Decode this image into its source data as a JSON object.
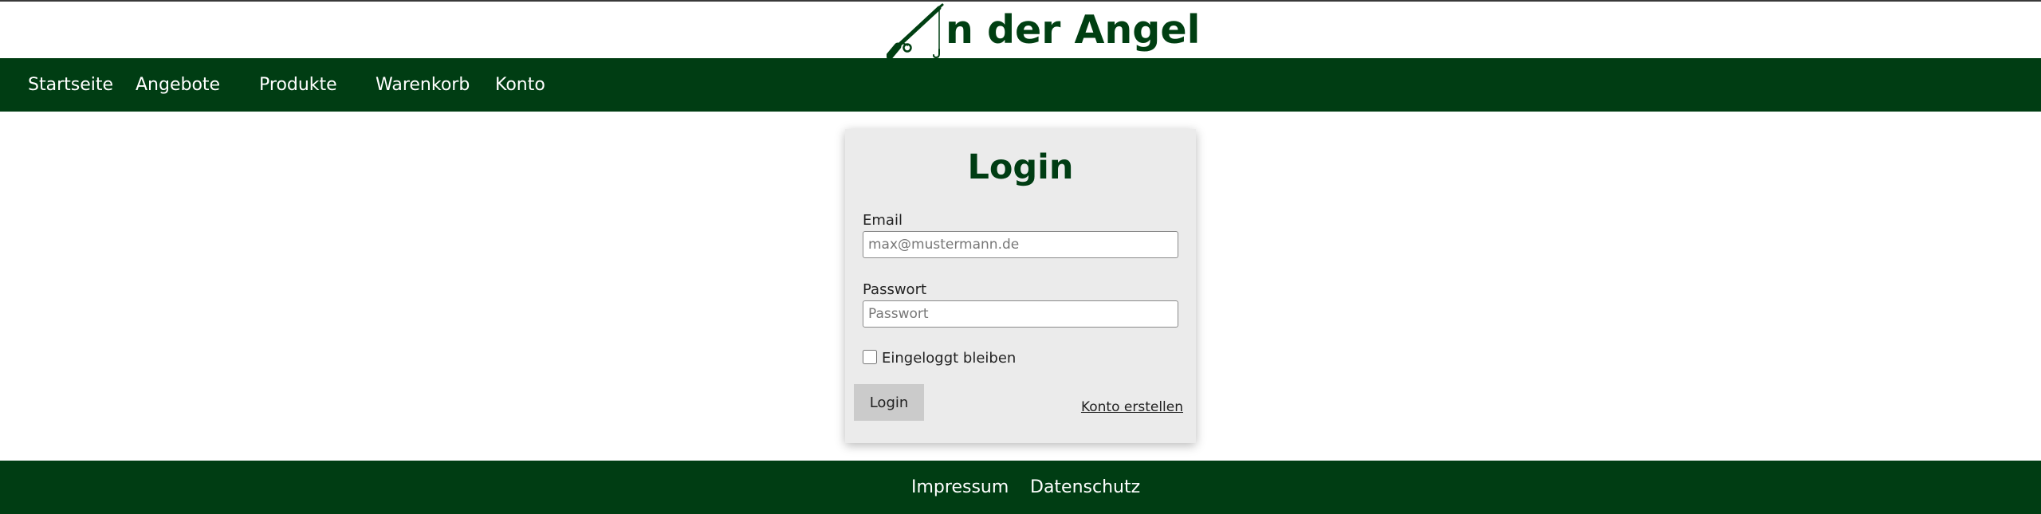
{
  "logo": {
    "text": "n der Angel",
    "icon": "fishing-rod-icon",
    "color": "#003f12"
  },
  "nav": {
    "items": [
      {
        "label": "Startseite"
      },
      {
        "label": "Angebote"
      },
      {
        "label": "Produkte"
      },
      {
        "label": "Warenkorb"
      },
      {
        "label": "Konto"
      }
    ],
    "background": "#003d13"
  },
  "login": {
    "title": "Login",
    "email_label": "Email",
    "email_placeholder": "max@mustermann.de",
    "password_label": "Passwort",
    "password_placeholder": "Passwort",
    "remember_label": "Eingeloggt bleiben",
    "remember_checked": false,
    "submit_label": "Login",
    "create_account_label": "Konto erstellen"
  },
  "footer": {
    "links": [
      {
        "label": "Impressum"
      },
      {
        "label": "Datenschutz"
      }
    ],
    "background": "#003d13"
  }
}
